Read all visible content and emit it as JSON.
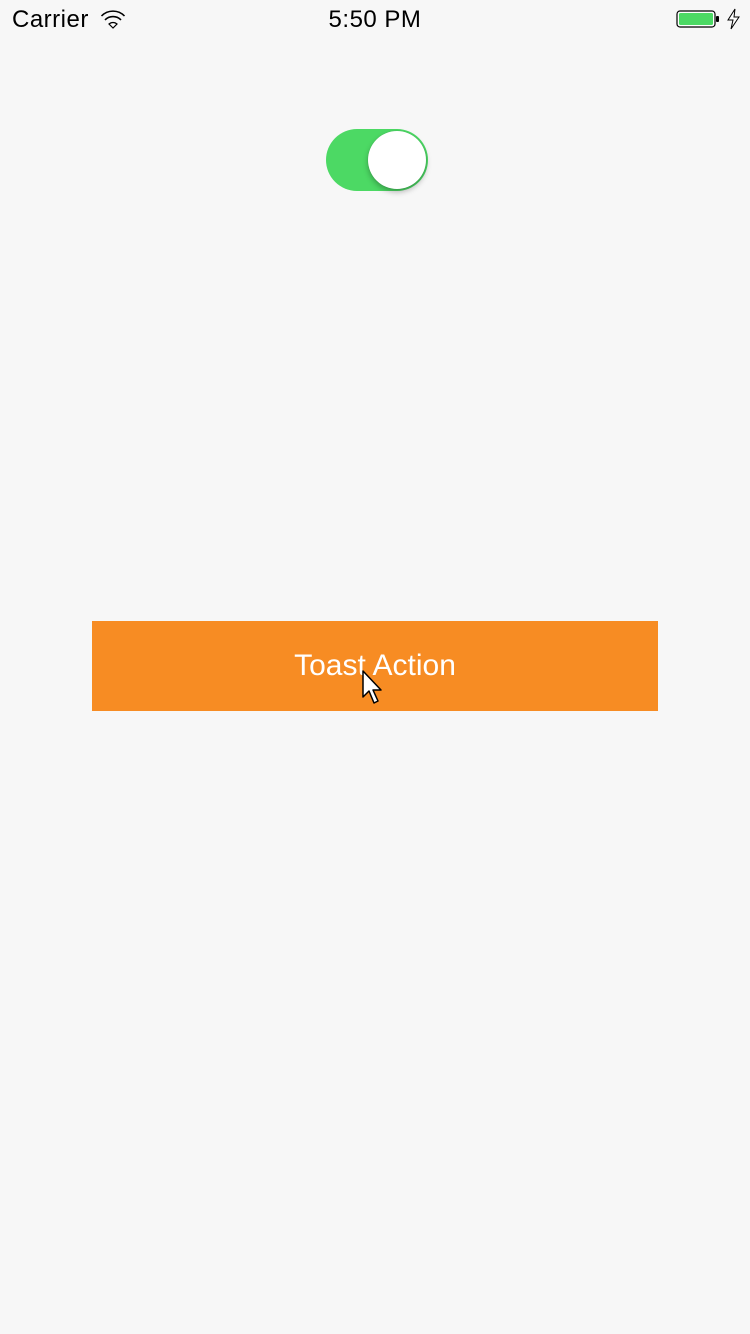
{
  "status_bar": {
    "carrier": "Carrier",
    "time": "5:50 PM",
    "icons": {
      "wifi": "wifi-icon",
      "battery": "battery-icon",
      "charging": "charging-icon"
    },
    "battery_color": "#4cd964"
  },
  "toggle": {
    "state": "on",
    "on_color": "#4cd964"
  },
  "main": {
    "toast_button_label": "Toast Action",
    "toast_button_color": "#f78c23"
  },
  "cursor": {
    "icon": "pointer-cursor-icon"
  }
}
